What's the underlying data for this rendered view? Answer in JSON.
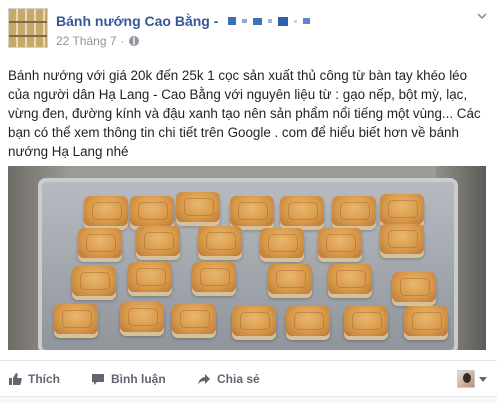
{
  "post": {
    "page_name": "Bánh nướng Cao Bằng -",
    "date": "22 Tháng 7",
    "separator": "·",
    "text": "Bánh nướng với giá 20k đến 25k 1 cọc sản xuất thủ công từ bàn tay khéo léo của người dân Hạ Lang - Cao Bằng với nguyên liệu từ : gạo nếp, bột mỳ, lạc, vừng đen, đường kính và đậu xanh tạo nên sản phẩm nổi tiếng một vùng... Các bạn có thể xem thông tin chi tiết trên Google . com để hiểu biết hơn về bánh nướng Hạ Lang nhé"
  },
  "actions": {
    "like_label": "Thích",
    "comment_label": "Bình luận",
    "share_label": "Chia sẻ"
  },
  "icons": {
    "privacy": "globe-icon",
    "menu": "chevron-down-icon",
    "like": "thumbs-up-icon",
    "comment": "speech-bubble-icon",
    "share": "share-arrow-icon"
  },
  "colors": {
    "link_blue": "#365899",
    "meta_gray": "#90949c",
    "action_gray": "#606770"
  }
}
